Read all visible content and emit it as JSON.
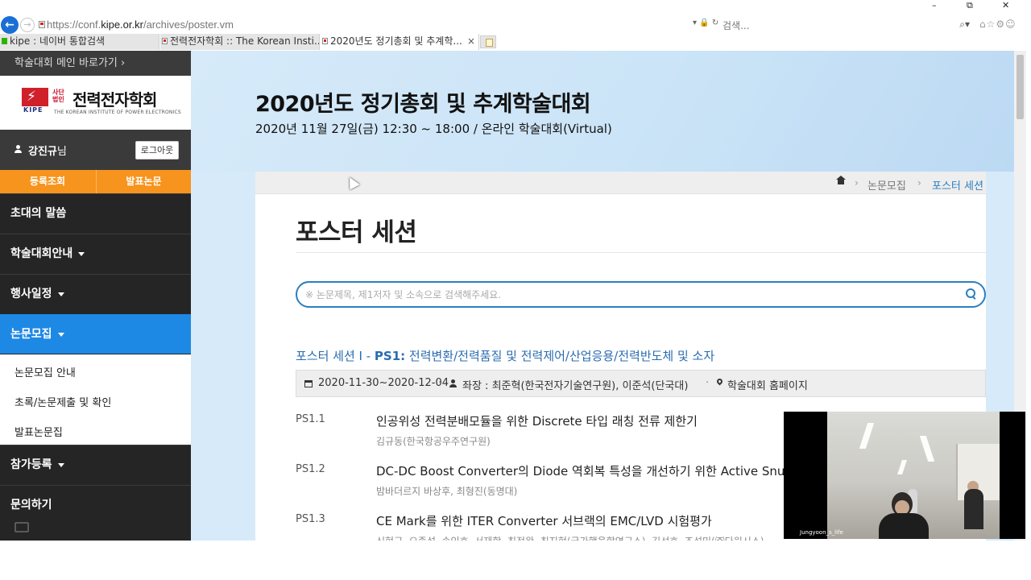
{
  "browser": {
    "url_prefix": "https://conf.",
    "url_domain": "kipe.or.kr",
    "url_path": "/archives/poster.vm",
    "search_placeholder": "검색...",
    "tabs": [
      {
        "label": "kipe : 네이버 통합검색"
      },
      {
        "label": "전력전자학회 :: The Korean Insti..."
      },
      {
        "label": "2020년도 정기총회 및 추계학..."
      }
    ],
    "win_minimize": "–",
    "win_restore": "⧉",
    "win_close": "✕",
    "tab_close": "×"
  },
  "sidebar": {
    "top_link": "학술대회 메인 바로가기 ›",
    "logo": {
      "kipe": "KIPE",
      "small_1": "사단",
      "small_2": "법인",
      "name": "전력전자학회",
      "english": "THE KOREAN INSTITUTE OF POWER ELECTRONICS"
    },
    "user": {
      "name": "강진규",
      "suffix": "님",
      "logout": "로그아웃"
    },
    "quick": {
      "register_check": "등록조회",
      "presentations": "발표논문"
    },
    "nav": [
      {
        "label": "초대의 말씀"
      },
      {
        "label": "학술대회안내"
      },
      {
        "label": "행사일정"
      },
      {
        "label": "논문모집"
      },
      {
        "label": "참가등록"
      },
      {
        "label": "문의하기"
      }
    ],
    "submenu": [
      {
        "label": "논문모집 안내"
      },
      {
        "label": "초록/논문제출 및 확인"
      },
      {
        "label": "발표논문집"
      }
    ]
  },
  "hero": {
    "title": "2020년도 정기총회 및 추계학술대회",
    "subtitle": "2020년 11월 27일(금) 12:30 ~ 18:00 / 온라인 학술대회(Virtual)"
  },
  "breadcrumb": {
    "items": [
      {
        "label": "논문모집"
      },
      {
        "label": "포스터 세션"
      }
    ],
    "separator": "›"
  },
  "page": {
    "title": "포스터 세션",
    "search_placeholder": "※ 논문제목, 제1저자 및 소속으로 검색해주세요."
  },
  "session": {
    "title_prefix": "포스터 세션 Ⅰ - ",
    "title_code": "PS1:",
    "title_rest": " 전력변환/전력품질 및 전력제어/산업응용/전력반도체 및 소자",
    "dates": "2020-11-30~2020-12-04",
    "chairs": "좌장 : 최준혁(한국전자기술연구원), 이준석(단국대)",
    "venue": "학술대회 홈페이지",
    "dot": "·"
  },
  "papers": [
    {
      "code": "PS1.1",
      "title": "인공위성 전력분배모듈을 위한 Discrete 타입 래칭 전류 제한기",
      "authors": "김규동(한국항공우주연구원)"
    },
    {
      "code": "PS1.2",
      "title": "DC-DC Boost Converter의 Diode 역회복 특성을 개선하기 위한 Active Snubber",
      "authors": "밤바더르지 바상후, 최형진(동명대)"
    },
    {
      "code": "PS1.3",
      "title": "CE Mark를 위한 ITER Converter 서브랙의 EMC/LVD 시험평가",
      "authors": "신현구, 오종석, 송인호, 서재학, 최정완, 최지현(국가핵융합연구소), 김선호, 조성민(㈜다원시스)"
    }
  ],
  "video": {
    "label": "Jungyoon_s_life"
  },
  "colors": {
    "accent": "#1e88e5",
    "orange": "#f7941d",
    "link": "#2b6cb0",
    "sidebar": "#252525"
  }
}
